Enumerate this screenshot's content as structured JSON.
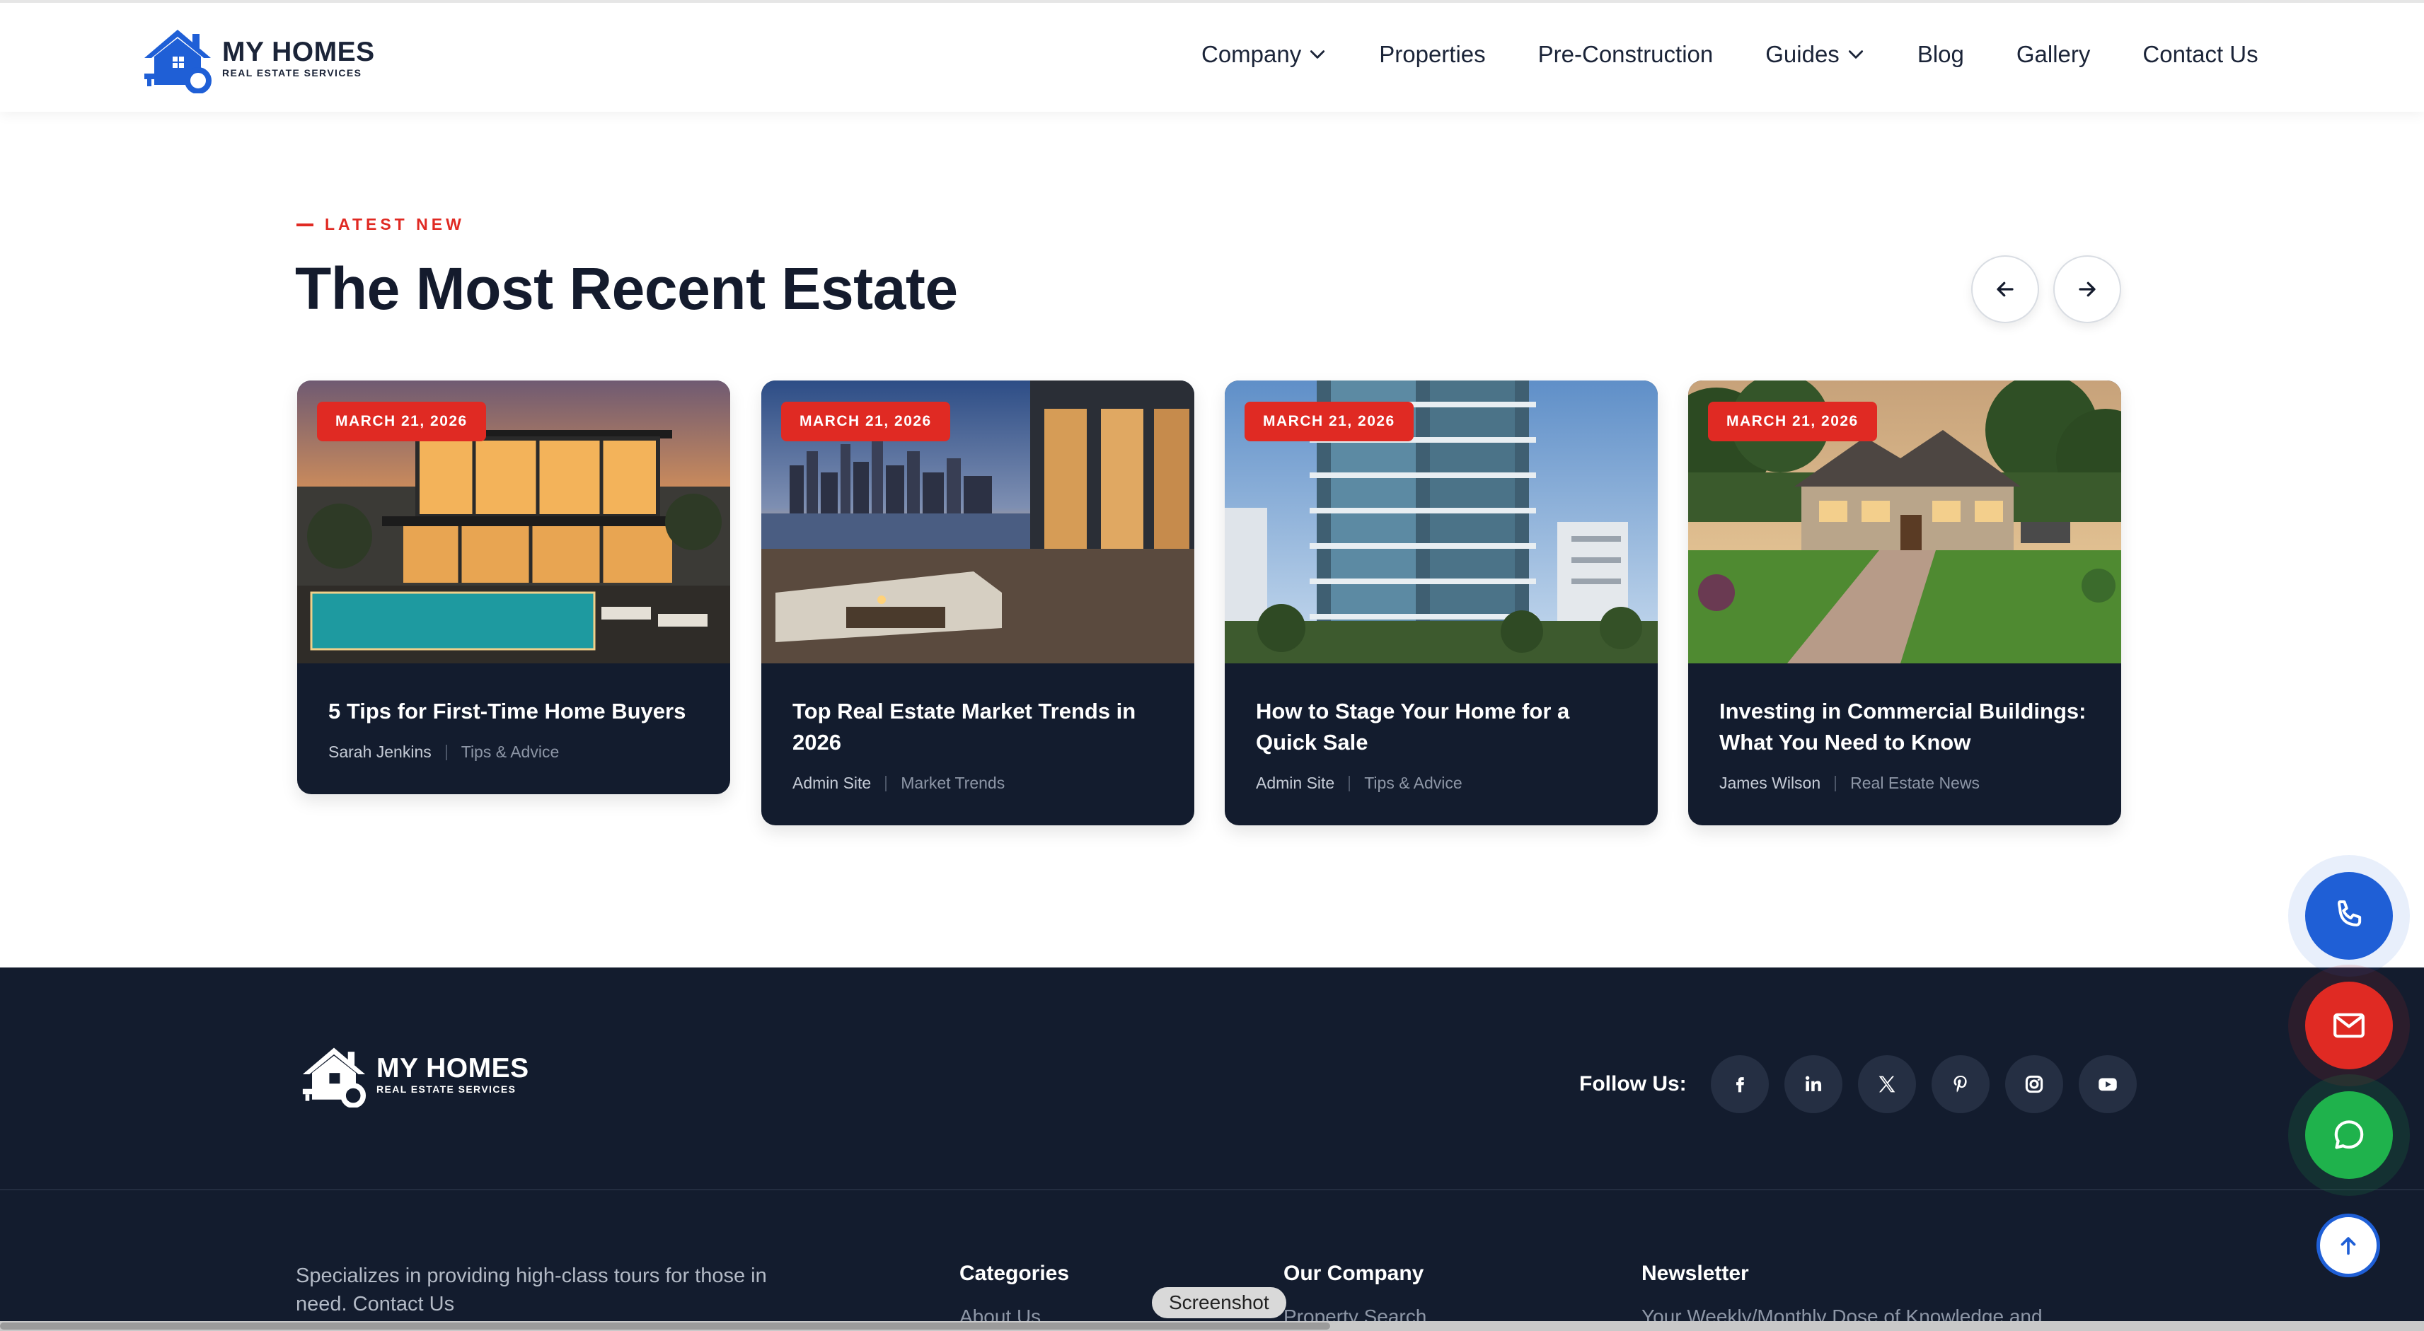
{
  "header": {
    "logo_title": "MY HOMES",
    "logo_subtitle": "REAL ESTATE SERVICES",
    "nav": [
      {
        "label": "Company",
        "has_dropdown": true
      },
      {
        "label": "Properties",
        "has_dropdown": false
      },
      {
        "label": "Pre-Construction",
        "has_dropdown": false
      },
      {
        "label": "Guides",
        "has_dropdown": true
      },
      {
        "label": "Blog",
        "has_dropdown": false
      },
      {
        "label": "Gallery",
        "has_dropdown": false
      },
      {
        "label": "Contact Us",
        "has_dropdown": false
      }
    ]
  },
  "section": {
    "eyebrow": "LATEST NEW",
    "title": "The Most Recent Estate",
    "prev_icon": "arrow-left-icon",
    "next_icon": "arrow-right-icon"
  },
  "posts": [
    {
      "date": "MARCH 21, 2026",
      "title": "5 Tips for First-Time Home Buyers",
      "author": "Sarah Jenkins",
      "category": "Tips & Advice",
      "image": "modern-villa-pool"
    },
    {
      "date": "MARCH 21, 2026",
      "title": "Top Real Estate Market Trends in 2026",
      "author": "Admin Site",
      "category": "Market Trends",
      "image": "city-terrace-night"
    },
    {
      "date": "MARCH 21, 2026",
      "title": "How to Stage Your Home for a Quick Sale",
      "author": "Admin Site",
      "category": "Tips & Advice",
      "image": "glass-tower"
    },
    {
      "date": "MARCH 21, 2026",
      "title": "Investing in Commercial Buildings: What You Need to Know",
      "author": "James Wilson",
      "category": "Real Estate News",
      "image": "suburban-house"
    }
  ],
  "footer": {
    "logo_title": "MY HOMES",
    "logo_subtitle": "REAL ESTATE SERVICES",
    "follow_label": "Follow Us:",
    "socials": [
      "facebook-icon",
      "linkedin-icon",
      "x-icon",
      "pinterest-icon",
      "instagram-icon",
      "youtube-icon"
    ],
    "description": "Specializes in providing high-class tours for those in need. Contact Us",
    "columns": [
      {
        "title": "Categories",
        "first_link": "About Us"
      },
      {
        "title": "Our Company",
        "first_link": "Property Search"
      },
      {
        "title": "Newsletter",
        "first_link": "Your Weekly/Monthly Dose of Knowledge and"
      }
    ]
  },
  "floating": {
    "buttons": [
      "phone-icon",
      "mail-icon",
      "whatsapp-icon",
      "arrow-up-icon"
    ],
    "colors": {
      "phone": "#1f5fd6",
      "mail": "#e02a23",
      "whatsapp": "#1fb24c"
    }
  },
  "tooltip": "Screenshot",
  "colors": {
    "accent": "#e02a23",
    "dark": "#131c2e",
    "heading": "#141b2d"
  }
}
